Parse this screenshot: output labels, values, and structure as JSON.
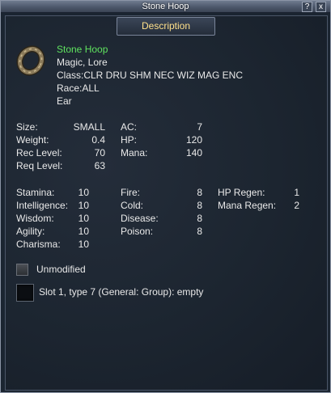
{
  "window": {
    "title": "Stone Hoop",
    "help_label": "?",
    "close_label": "x"
  },
  "tab": {
    "label": "Description"
  },
  "item": {
    "name": "Stone Hoop",
    "flags": "Magic, Lore",
    "classes": "Class:CLR DRU SHM NEC WIZ MAG ENC",
    "race": "Race:ALL",
    "slot": "Ear",
    "icon": "stone-hoop-ring-icon"
  },
  "basic_stats": [
    {
      "label": "Size:",
      "value": "SMALL"
    },
    {
      "label": "Weight:",
      "value": "0.4"
    },
    {
      "label": "Rec Level:",
      "value": "70"
    },
    {
      "label": "Req Level:",
      "value": "63"
    }
  ],
  "combat_stats": [
    {
      "label": "AC:",
      "value": "7"
    },
    {
      "label": "HP:",
      "value": "120"
    },
    {
      "label": "Mana:",
      "value": "140"
    }
  ],
  "attributes": [
    {
      "label": "Stamina:",
      "value": "10"
    },
    {
      "label": "Intelligence:",
      "value": "10"
    },
    {
      "label": "Wisdom:",
      "value": "10"
    },
    {
      "label": "Agility:",
      "value": "10"
    },
    {
      "label": "Charisma:",
      "value": "10"
    }
  ],
  "resists": [
    {
      "label": "Fire:",
      "value": "8"
    },
    {
      "label": "Cold:",
      "value": "8"
    },
    {
      "label": "Disease:",
      "value": "8"
    },
    {
      "label": "Poison:",
      "value": "8"
    }
  ],
  "regen": [
    {
      "label": "HP Regen:",
      "value": "1"
    },
    {
      "label": "Mana Regen:",
      "value": "2"
    }
  ],
  "modifier": {
    "label": "Unmodified"
  },
  "augment_slot": {
    "label": "Slot 1, type 7 (General: Group): empty"
  }
}
